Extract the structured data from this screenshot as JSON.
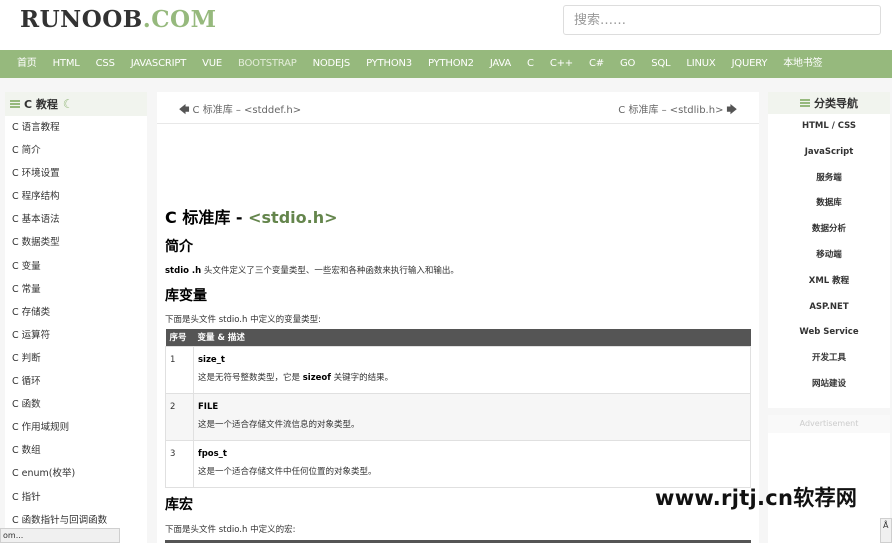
{
  "header": {
    "logo_part1": "RUNOOB",
    "logo_part2": ".COM",
    "search_placeholder": "搜索……"
  },
  "nav": [
    "首页",
    "HTML",
    "CSS",
    "JAVASCRIPT",
    "VUE",
    "BOOTSTRAP",
    "NODEJS",
    "PYTHON3",
    "PYTHON2",
    "JAVA",
    "C",
    "C++",
    "C#",
    "GO",
    "SQL",
    "LINUX",
    "JQUERY",
    "本地书签"
  ],
  "sidebar": {
    "title": "C 教程",
    "items": [
      "C 语言教程",
      "C 简介",
      "C 环境设置",
      "C 程序结构",
      "C 基本语法",
      "C 数据类型",
      "C 变量",
      "C 常量",
      "C 存储类",
      "C 运算符",
      "C 判断",
      "C 循环",
      "C 函数",
      "C 作用域规则",
      "C 数组",
      "C enum(枚举)",
      "C 指针",
      "C 函数指针与回调函数"
    ]
  },
  "content": {
    "prev": "C 标准库 – <stddef.h>",
    "next": "C 标准库 – <stdlib.h>",
    "title_prefix": "C 标准库 - ",
    "title_highlight": "<stdio.h>",
    "intro_heading": "简介",
    "intro_bold": "stdio .h",
    "intro_text": " 头文件定义了三个变量类型、一些宏和各种函数来执行输入和输出。",
    "vars_heading": "库变量",
    "vars_text": "下面是头文件 stdio.h 中定义的变量类型:",
    "table_headers": [
      "序号",
      "变量 & 描述"
    ],
    "rows": [
      {
        "num": "1",
        "name": "size_t",
        "desc_pre": "这是无符号整数类型，它是 ",
        "desc_bold": "sizeof",
        "desc_post": " 关键字的结果。"
      },
      {
        "num": "2",
        "name": "FILE",
        "desc_pre": "这是一个适合存储文件流信息的对象类型。",
        "desc_bold": "",
        "desc_post": ""
      },
      {
        "num": "3",
        "name": "fpos_t",
        "desc_pre": "这是一个适合存储文件中任何位置的对象类型。",
        "desc_bold": "",
        "desc_post": ""
      }
    ],
    "macros_heading": "库宏",
    "macros_text": "下面是头文件 stdio.h 中定义的宏:"
  },
  "right_nav": {
    "title": "分类导航",
    "items": [
      "HTML / CSS",
      "JavaScript",
      "服务端",
      "数据库",
      "数据分析",
      "移动端",
      "XML 教程",
      "ASP.NET",
      "Web Service",
      "开发工具",
      "网站建设"
    ]
  },
  "advert_label": "Advertisement",
  "watermark": "www.rjtj.cn软荐网",
  "statusbar": "om...",
  "corner": "Å"
}
